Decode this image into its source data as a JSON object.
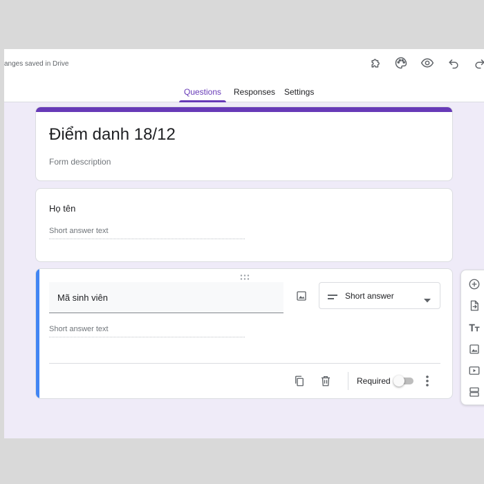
{
  "header": {
    "saved_status": "anges saved in Drive",
    "icons": [
      "add-on-puzzle-icon",
      "palette-icon",
      "eye-preview-icon",
      "undo-icon",
      "redo-icon"
    ]
  },
  "tabs": [
    {
      "label": "Questions",
      "active": true
    },
    {
      "label": "Responses",
      "active": false
    },
    {
      "label": "Settings",
      "active": false
    }
  ],
  "form": {
    "title": "Điểm danh 18/12",
    "description_placeholder": "Form description"
  },
  "questions": [
    {
      "title": "Họ tên",
      "answer_placeholder": "Short answer text"
    },
    {
      "title": "Mã sinh viên",
      "answer_placeholder": "Short answer text",
      "type": "Short answer",
      "required_label": "Required",
      "required": false
    }
  ],
  "side_toolbar": {
    "icons": [
      "add-question-icon",
      "import-questions-icon",
      "add-title-icon",
      "add-image-icon",
      "add-video-icon",
      "add-section-icon"
    ]
  },
  "colors": {
    "accent": "#673ab7",
    "active_question_accent": "#4285f4",
    "background": "#efebf8"
  }
}
